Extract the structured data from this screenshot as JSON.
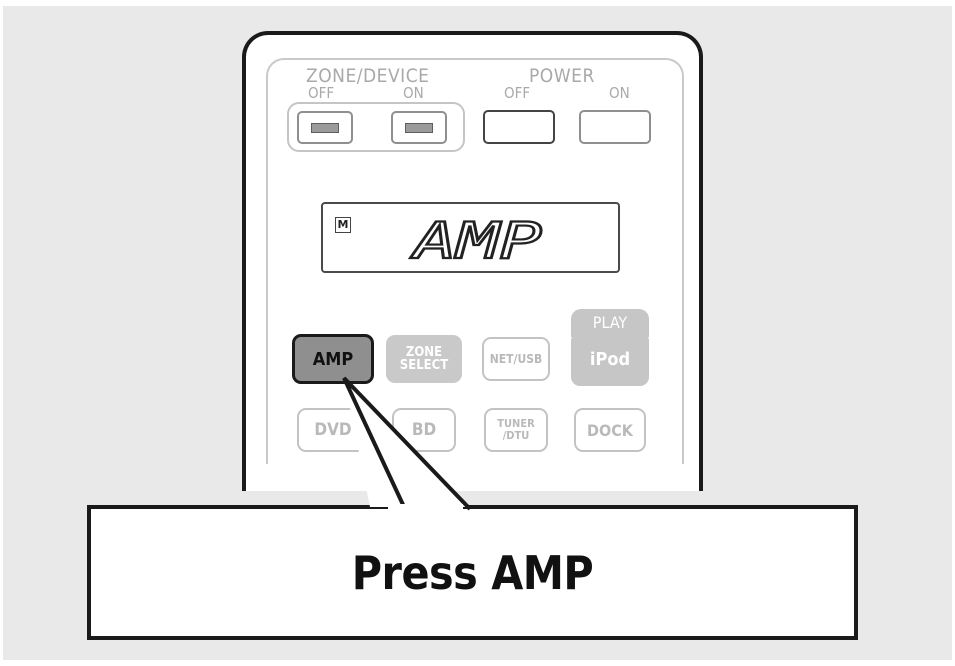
{
  "remote": {
    "zone_device_label": "ZONE/DEVICE",
    "zone_off_label": "OFF",
    "zone_on_label": "ON",
    "power_label": "POWER",
    "power_off_label": "OFF",
    "power_on_label": "ON",
    "display": {
      "mode_indicator": "M",
      "text": "AMP"
    },
    "buttons": {
      "amp": "AMP",
      "zone_select_line1": "ZONE",
      "zone_select_line2": "SELECT",
      "net_usb": "NET/USB",
      "play_label": "PLAY",
      "ipod": "iPod",
      "dvd": "DVD",
      "bd": "BD",
      "tuner_line1": "TUNER",
      "tuner_line2": "/DTU",
      "dock": "DOCK"
    }
  },
  "callout": {
    "text": "Press AMP"
  },
  "colors": {
    "background": "#e9e9ea",
    "highlight_button": "#8f8f8f",
    "dim_button": "#c6c6c6",
    "outline": "#1a1a1a"
  }
}
